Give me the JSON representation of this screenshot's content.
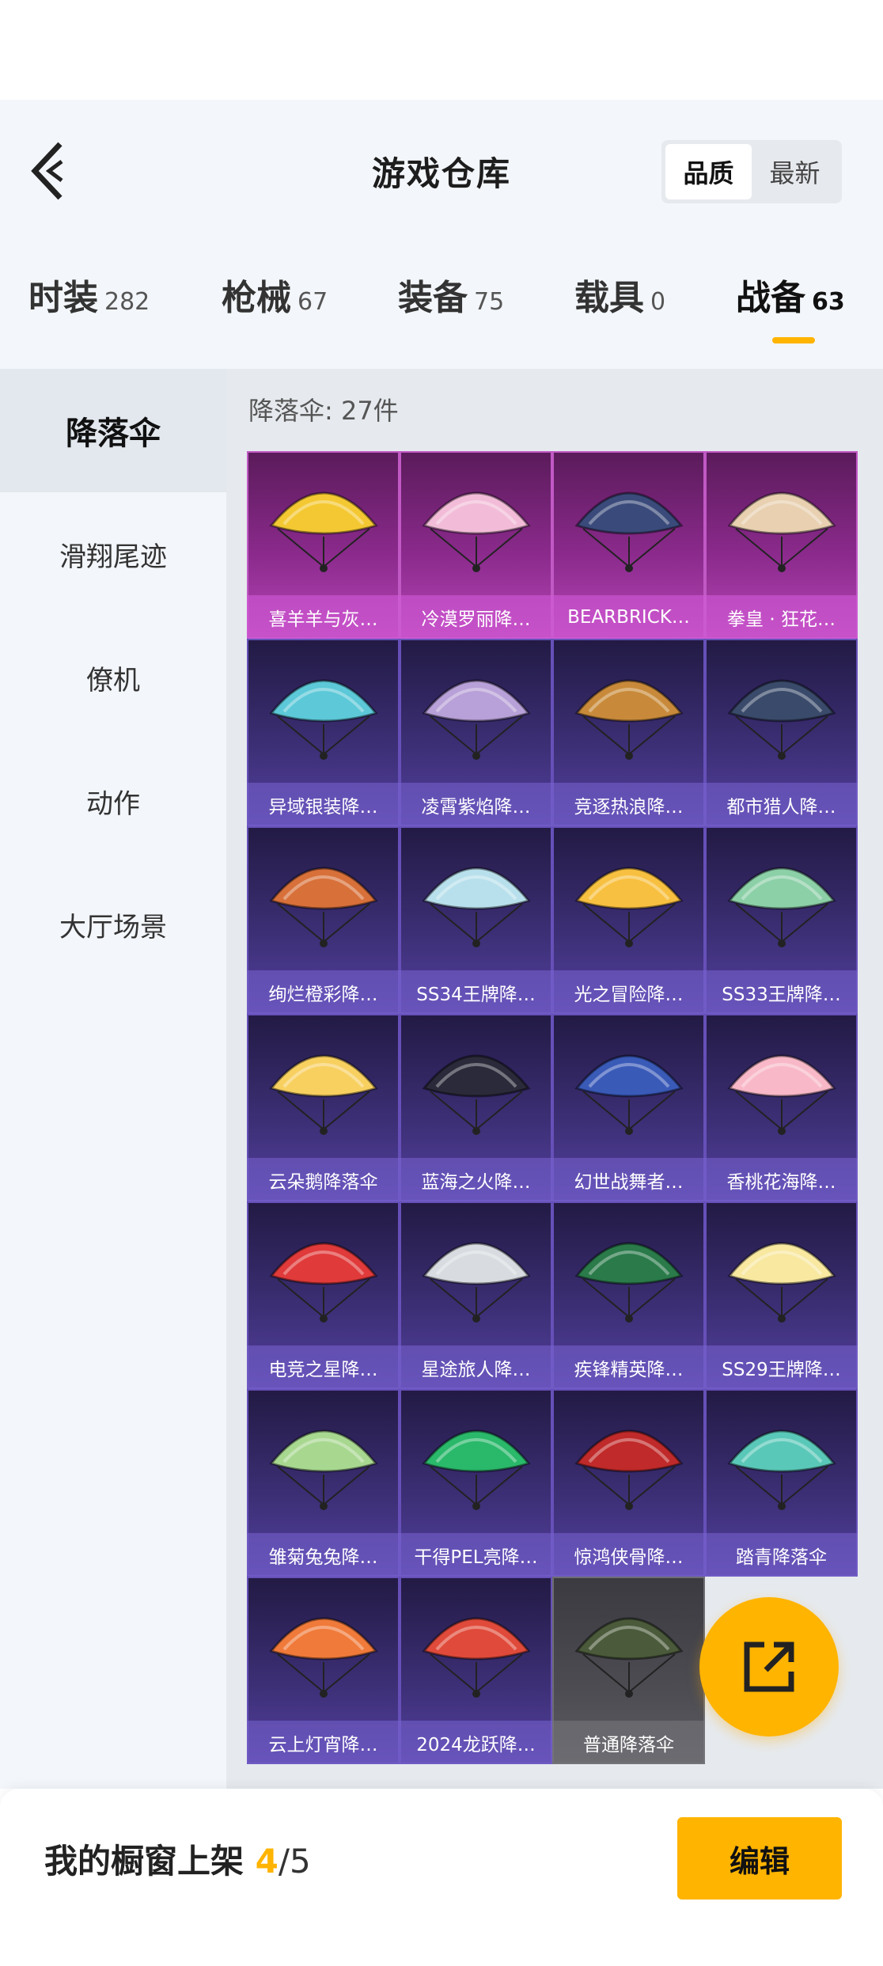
{
  "header": {
    "title": "游戏仓库",
    "sort_options": [
      "品质",
      "最新"
    ],
    "selected_sort": "品质"
  },
  "tabs": [
    {
      "label": "时装",
      "count": "282",
      "active": false
    },
    {
      "label": "枪械",
      "count": "67",
      "active": false
    },
    {
      "label": "装备",
      "count": "75",
      "active": false
    },
    {
      "label": "载具",
      "count": "0",
      "active": false
    },
    {
      "label": "战备",
      "count": "63",
      "active": true
    }
  ],
  "sidebar": {
    "items": [
      {
        "label": "降落伞",
        "active": true
      },
      {
        "label": "滑翔尾迹",
        "active": false
      },
      {
        "label": "僚机",
        "active": false
      },
      {
        "label": "动作",
        "active": false
      },
      {
        "label": "大厅场景",
        "active": false
      }
    ]
  },
  "content": {
    "count_label": "降落伞: 27件",
    "items": [
      {
        "name": "喜羊羊与灰…",
        "rarity": "legend",
        "color": "#f4c832"
      },
      {
        "name": "冷漠罗丽降…",
        "rarity": "legend",
        "color": "#f2bcd8"
      },
      {
        "name": "BEARBRICK…",
        "rarity": "legend",
        "color": "#3a4a7a"
      },
      {
        "name": "拳皇 · 狂花…",
        "rarity": "legend",
        "color": "#e8d0b0"
      },
      {
        "name": "异域银装降…",
        "rarity": "epic",
        "color": "#5cc8d8"
      },
      {
        "name": "凌霄紫焰降…",
        "rarity": "epic",
        "color": "#b8a0d8"
      },
      {
        "name": "竞逐热浪降…",
        "rarity": "epic",
        "color": "#c88a3a"
      },
      {
        "name": "都市猎人降…",
        "rarity": "epic",
        "color": "#3a4a6a"
      },
      {
        "name": "绚烂橙彩降…",
        "rarity": "epic",
        "color": "#d8703a"
      },
      {
        "name": "SS34王牌降…",
        "rarity": "epic",
        "color": "#b8e0ec"
      },
      {
        "name": "光之冒险降…",
        "rarity": "epic",
        "color": "#f8c040"
      },
      {
        "name": "SS33王牌降…",
        "rarity": "epic",
        "color": "#8cd0a8"
      },
      {
        "name": "云朵鹅降落伞",
        "rarity": "epic",
        "color": "#f8d060"
      },
      {
        "name": "蓝海之火降…",
        "rarity": "epic",
        "color": "#2a2a3a"
      },
      {
        "name": "幻世战舞者…",
        "rarity": "epic",
        "color": "#3a5ab8"
      },
      {
        "name": "香桃花海降…",
        "rarity": "epic",
        "color": "#f8b8c8"
      },
      {
        "name": "电竞之星降…",
        "rarity": "epic",
        "color": "#e03a3a"
      },
      {
        "name": "星途旅人降…",
        "rarity": "epic",
        "color": "#d8dce0"
      },
      {
        "name": "疾锋精英降…",
        "rarity": "epic",
        "color": "#2a7a4a"
      },
      {
        "name": "SS29王牌降…",
        "rarity": "epic",
        "color": "#f8e8a0"
      },
      {
        "name": "雏菊兔兔降…",
        "rarity": "epic",
        "color": "#a8d890"
      },
      {
        "name": "干得PEL亮降…",
        "rarity": "epic",
        "color": "#2ab86a"
      },
      {
        "name": "惊鸿侠骨降…",
        "rarity": "epic",
        "color": "#c02a2a"
      },
      {
        "name": "踏青降落伞",
        "rarity": "epic",
        "color": "#5ac8b8"
      },
      {
        "name": "云上灯宵降…",
        "rarity": "epic",
        "color": "#f07a3a"
      },
      {
        "name": "2024龙跃降…",
        "rarity": "epic",
        "color": "#e04a3a"
      },
      {
        "name": "普通降落伞",
        "rarity": "common",
        "color": "#4a5a3a"
      }
    ]
  },
  "bottom": {
    "showcase_label": "我的橱窗上架",
    "showcase_current": "4",
    "showcase_total": "/5",
    "edit_label": "编辑"
  },
  "colors": {
    "accent": "#ffb400",
    "legend": "#b646b6",
    "epic": "#5440a0",
    "common": "#5c5c62"
  }
}
